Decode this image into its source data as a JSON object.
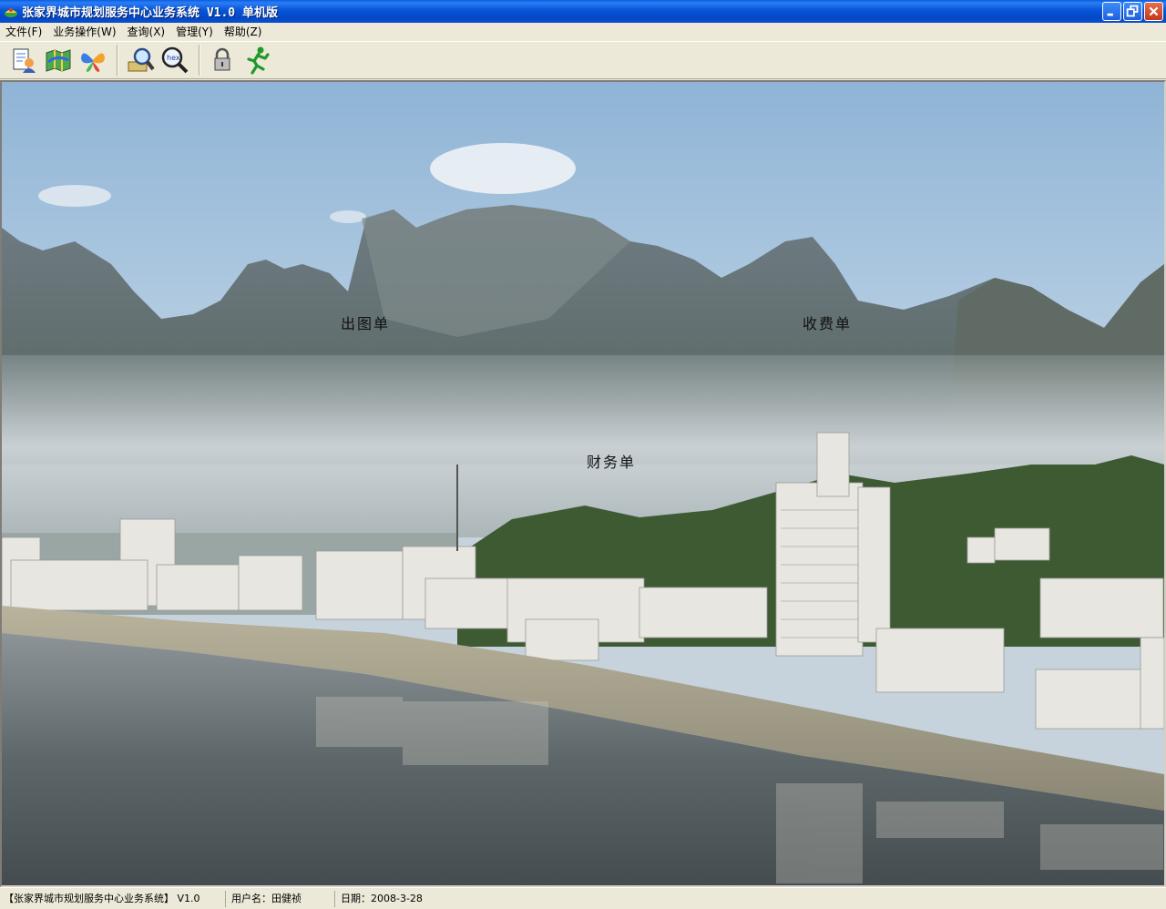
{
  "window": {
    "title": "张家界城市规划服务中心业务系统 V1.0  单机版"
  },
  "menu": [
    {
      "label": "文件(F)"
    },
    {
      "label": "业务操作(W)"
    },
    {
      "label": "查询(X)"
    },
    {
      "label": "管理(Y)"
    },
    {
      "label": "帮助(Z)"
    }
  ],
  "toolbar": {
    "icons": [
      "document-user-icon",
      "map-icon",
      "butterfly-icon",
      "magnify-search-icon",
      "hex-search-icon",
      "lock-icon",
      "running-man-icon"
    ]
  },
  "overlay": {
    "chutu": "出图单",
    "shoufei": "收费单",
    "caiwu": "财务单"
  },
  "status": {
    "app": "【张家界城市规划服务中心业务系统】 V1.0",
    "user": "用户名：田健祯",
    "date": "日期：2008-3-28"
  },
  "colors": {
    "titlebar": "#0a56d8",
    "chrome": "#ece9d8",
    "close": "#c2391a"
  }
}
